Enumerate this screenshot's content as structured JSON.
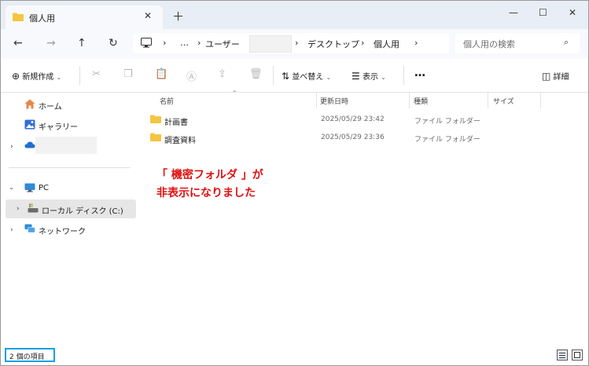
{
  "tab": {
    "title": "個人用"
  },
  "address": {
    "ellipsis": "…",
    "segments": [
      "ユーザー",
      "デスクトップ",
      "個人用"
    ]
  },
  "search": {
    "placeholder": "個人用の検索"
  },
  "toolbar": {
    "new_label": "新規作成",
    "sort_label": "並べ替え",
    "view_label": "表示",
    "more_label": "…",
    "details_label": "詳細"
  },
  "sidebar": {
    "items": [
      {
        "label": "ホーム",
        "icon": "home-icon"
      },
      {
        "label": "ギャラリー",
        "icon": "gallery-icon"
      },
      {
        "label": "",
        "icon": "onedrive-icon"
      },
      {
        "label": "PC",
        "icon": "pc-icon"
      },
      {
        "label": "ローカル ディスク (C:)",
        "icon": "drive-icon"
      },
      {
        "label": "ネットワーク",
        "icon": "network-icon"
      }
    ]
  },
  "columns": {
    "name": "名前",
    "date": "更新日時",
    "type": "種類",
    "size": "サイズ"
  },
  "files": [
    {
      "name": "計画書",
      "date": "2025/05/29 23:42",
      "type": "ファイル フォルダー"
    },
    {
      "name": "調査資料",
      "date": "2025/05/29 23:36",
      "type": "ファイル フォルダー"
    }
  ],
  "annotation": {
    "line1": "「 機密フォルダ 」が",
    "line2": "非表示になりました"
  },
  "status": {
    "item_count": "2 個の項目"
  },
  "colors": {
    "accent": "#1aa0e0",
    "annotation": "#e01010",
    "folder": "#f4c542"
  }
}
